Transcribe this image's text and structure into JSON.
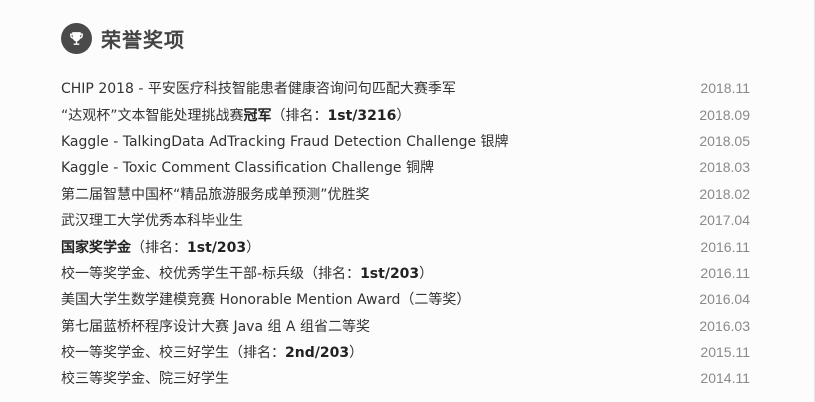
{
  "section": {
    "title": "荣誉奖项",
    "icon": "trophy-icon"
  },
  "awards": [
    {
      "parts": [
        {
          "text": "CHIP 2018 - 平安医疗科技智能患者健康咨询问句匹配大赛季军",
          "bold": false
        }
      ],
      "date": "2018.11"
    },
    {
      "parts": [
        {
          "text": "“达观杯”文本智能处理挑战赛",
          "bold": false
        },
        {
          "text": "冠军",
          "bold": true
        },
        {
          "text": "（排名：",
          "bold": false
        },
        {
          "text": "1st/3216",
          "bold": true
        },
        {
          "text": "）",
          "bold": false
        }
      ],
      "date": "2018.09"
    },
    {
      "parts": [
        {
          "text": "Kaggle - TalkingData AdTracking Fraud Detection Challenge 银牌",
          "bold": false
        }
      ],
      "date": "2018.05"
    },
    {
      "parts": [
        {
          "text": "Kaggle - Toxic Comment Classification Challenge 铜牌",
          "bold": false
        }
      ],
      "date": "2018.03"
    },
    {
      "parts": [
        {
          "text": "第二届智慧中国杯“精品旅游服务成单预测”优胜奖",
          "bold": false
        }
      ],
      "date": "2018.02"
    },
    {
      "parts": [
        {
          "text": "武汉理工大学优秀本科毕业生",
          "bold": false
        }
      ],
      "date": "2017.04"
    },
    {
      "parts": [
        {
          "text": "国家奖学金",
          "bold": true
        },
        {
          "text": "（排名：",
          "bold": false
        },
        {
          "text": "1st/203",
          "bold": true
        },
        {
          "text": "）",
          "bold": false
        }
      ],
      "date": "2016.11"
    },
    {
      "parts": [
        {
          "text": "校一等奖学金、校优秀学生干部-标兵级（排名：",
          "bold": false
        },
        {
          "text": "1st/203",
          "bold": true
        },
        {
          "text": "）",
          "bold": false
        }
      ],
      "date": "2016.11"
    },
    {
      "parts": [
        {
          "text": "美国大学生数学建模竞赛 Honorable Mention Award（二等奖）",
          "bold": false
        }
      ],
      "date": "2016.04"
    },
    {
      "parts": [
        {
          "text": "第七届蓝桥杯程序设计大赛 Java 组 A 组省二等奖",
          "bold": false
        }
      ],
      "date": "2016.03"
    },
    {
      "parts": [
        {
          "text": "校一等奖学金、校三好学生（排名：",
          "bold": false
        },
        {
          "text": "2nd/203",
          "bold": true
        },
        {
          "text": "）",
          "bold": false
        }
      ],
      "date": "2015.11"
    },
    {
      "parts": [
        {
          "text": "校三等奖学金、院三好学生",
          "bold": false
        }
      ],
      "date": "2014.11"
    }
  ],
  "colors": {
    "badge": "#4a4a4a",
    "text": "#333333",
    "date": "#8a8a8a",
    "background": "#fcfcfc"
  }
}
